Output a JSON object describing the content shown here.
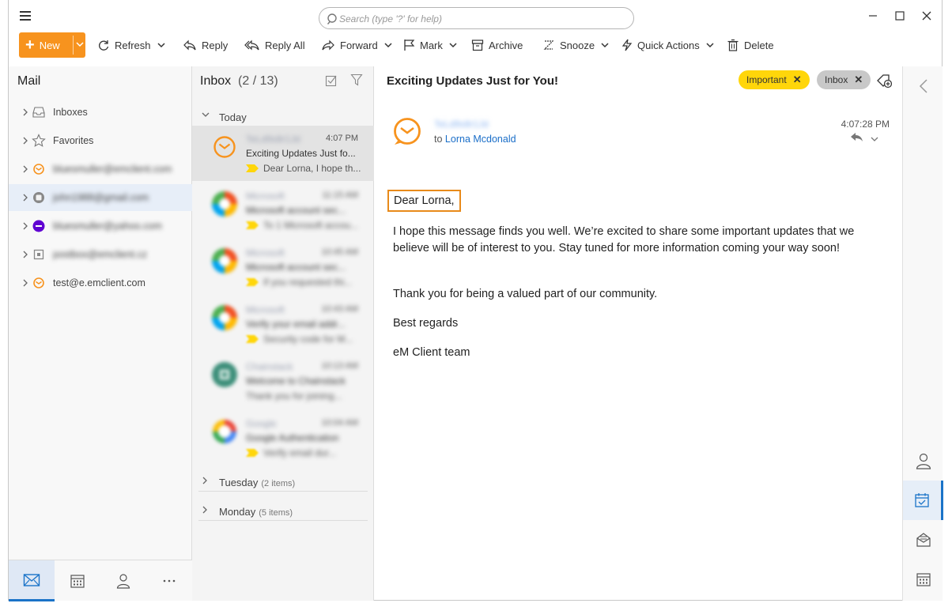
{
  "search": {
    "placeholder": "Search (type '?' for help)"
  },
  "toolbar": {
    "new": "New",
    "refresh": "Refresh",
    "reply": "Reply",
    "reply_all": "Reply All",
    "forward": "Forward",
    "mark": "Mark",
    "archive": "Archive",
    "snooze": "Snooze",
    "quick_actions": "Quick Actions",
    "delete": "Delete"
  },
  "sidebar": {
    "title": "Mail",
    "items": [
      {
        "label": "Inboxes",
        "icon": "inbox-icon"
      },
      {
        "label": "Favorites",
        "icon": "star-icon"
      },
      {
        "label": "bluesmuller@emclient.com",
        "icon": "emclient-icon",
        "blurred": true
      },
      {
        "label": "john1988@gmail.com",
        "icon": "account-icon",
        "blurred": true
      },
      {
        "label": "bluesmuller@yahoo.com",
        "icon": "yahoo-icon",
        "blurred": true
      },
      {
        "label": "postbox@emclient.cz",
        "icon": "account-icon",
        "blurred": true
      },
      {
        "label": "test@e.emclient.com",
        "icon": "emclient-icon"
      }
    ]
  },
  "message_list": {
    "title": "Inbox",
    "count": "(2 / 13)",
    "groups": {
      "today": "Today",
      "tuesday": "Tuesday",
      "tuesday_count": "(2 items)",
      "monday": "Monday",
      "monday_count": "(5 items)"
    },
    "selected": {
      "from": "TeLd9s8r1Jd",
      "time": "4:07 PM",
      "subject": "Exciting Updates Just fo...",
      "preview": "Dear Lorna, I hope th..."
    },
    "others": [
      {
        "from": "Microsoft",
        "time": "11:15 AM",
        "subject": "Microsoft account sec...",
        "preview": "To 1 Microsoft accou..."
      },
      {
        "from": "Microsoft",
        "time": "10:45 AM",
        "subject": "Microsoft account sec...",
        "preview": "If you requested thi..."
      },
      {
        "from": "Microsoft",
        "time": "10:43 AM",
        "subject": "Verify your email addr...",
        "preview": "Security code for M..."
      },
      {
        "from": "Chainstack",
        "time": "10:13 AM",
        "subject": "Welcome to Chainstack",
        "preview": "Thank you for joining..."
      },
      {
        "from": "Google",
        "time": "10:04 AM",
        "subject": "Google Authentication",
        "preview": "Verify email dur..."
      }
    ]
  },
  "reader": {
    "subject": "Exciting Updates Just for You!",
    "tags": [
      "Important",
      "Inbox"
    ],
    "from": "TeLd9s8r1Jd",
    "to_prefix": "to",
    "to": "Lorna Mcdonald",
    "time": "4:07:28 PM",
    "greeting": "Dear Lorna,",
    "paragraphs": [
      "I hope this message finds you well. We’re excited to share some important updates that we believe will be of interest to you. Stay tuned for more information coming your way soon!",
      "Thank you for being a valued part of our community.",
      "Best regards",
      "eM Client team"
    ]
  },
  "colors": {
    "accent": "#f7931e",
    "link": "#1a6ec8",
    "important_tag": "#ffd60a",
    "selection_bar": "#1a73c8"
  }
}
